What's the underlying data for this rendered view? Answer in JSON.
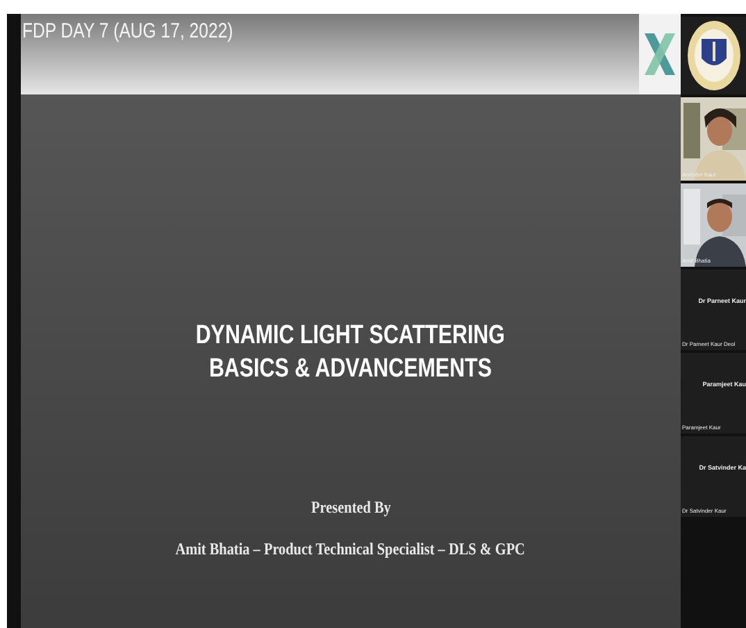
{
  "meeting_title": "FDP DAY 7 (AUG 17, 2022)",
  "slide": {
    "title_lines": [
      "DYNAMIC LIGHT SCATTERING",
      "BASICS & ADVANCEMENTS"
    ],
    "presented_by": "Presented By",
    "presenter": "Amit Bhatia – Product Technical Specialist – DLS & GPC"
  },
  "participants": [
    {
      "kind": "logo"
    },
    {
      "kind": "video",
      "caption": "Arvinder Kaur"
    },
    {
      "kind": "video",
      "caption": "Amit Bhatia"
    },
    {
      "kind": "name",
      "name": "Dr Parneet Kaur",
      "caption": "Dr Parneet Kaur Deol"
    },
    {
      "kind": "name",
      "name": "Paramjeet Kau",
      "caption": "Paramjeet Kaur"
    },
    {
      "kind": "name",
      "name": "Dr Satvinder Ka",
      "caption": "Dr Satvinder Kaur"
    }
  ]
}
